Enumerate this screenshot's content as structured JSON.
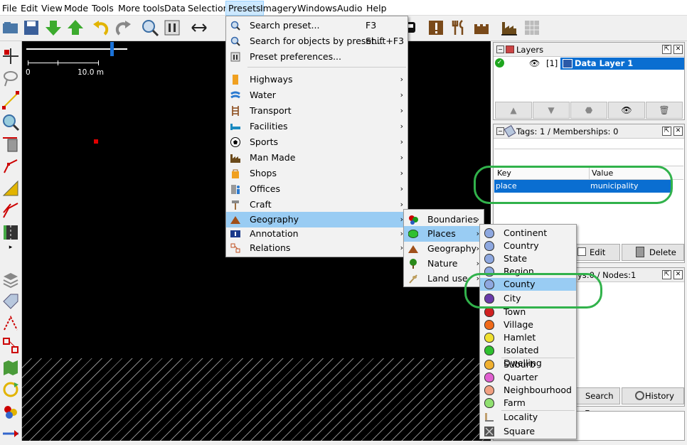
{
  "menubar": [
    "File",
    "Edit",
    "View",
    "Mode",
    "Tools",
    "More tools",
    "Data",
    "Selection",
    "Presets",
    "Imagery",
    "Windows",
    "Audio",
    "Help"
  ],
  "map": {
    "scale_start": "0",
    "scale_end": "10.0 m"
  },
  "presets_menu": {
    "search_preset": "Search preset...",
    "search_preset_sc": "F3",
    "search_objects": "Search for objects by preset...",
    "search_objects_sc": "Shift+F3",
    "preferences": "Preset preferences...",
    "groups": [
      "Highways",
      "Water",
      "Transport",
      "Facilities",
      "Sports",
      "Man Made",
      "Shops",
      "Offices",
      "Craft",
      "Geography",
      "Annotation",
      "Relations"
    ]
  },
  "geo_submenu": [
    "Boundaries",
    "Places",
    "Geography",
    "Nature",
    "Land use"
  ],
  "places_submenu": [
    "Continent",
    "Country",
    "State",
    "Region",
    "County",
    "City",
    "Town",
    "Village",
    "Hamlet",
    "Isolated Dwelling",
    "Suburb",
    "Quarter",
    "Neighbourhood",
    "Farm",
    "Locality",
    "Square"
  ],
  "layers": {
    "title": "Layers",
    "index": "[1]",
    "name": "Data Layer 1"
  },
  "tags": {
    "title": "Tags: 1 / Memberships: 0",
    "col_key": "Key",
    "col_value": "Value",
    "key": "place",
    "value": "municipality",
    "edit": "Edit",
    "delete": "Delete"
  },
  "selection": {
    "title_partial": "ys:0 / Nodes:1",
    "search": "Search",
    "history": "History"
  },
  "colors": {
    "highlight": "#0078d7",
    "menu_hl": "#99ccf3",
    "annotation": "#31b24b",
    "active_menu": "#cce8ff"
  }
}
